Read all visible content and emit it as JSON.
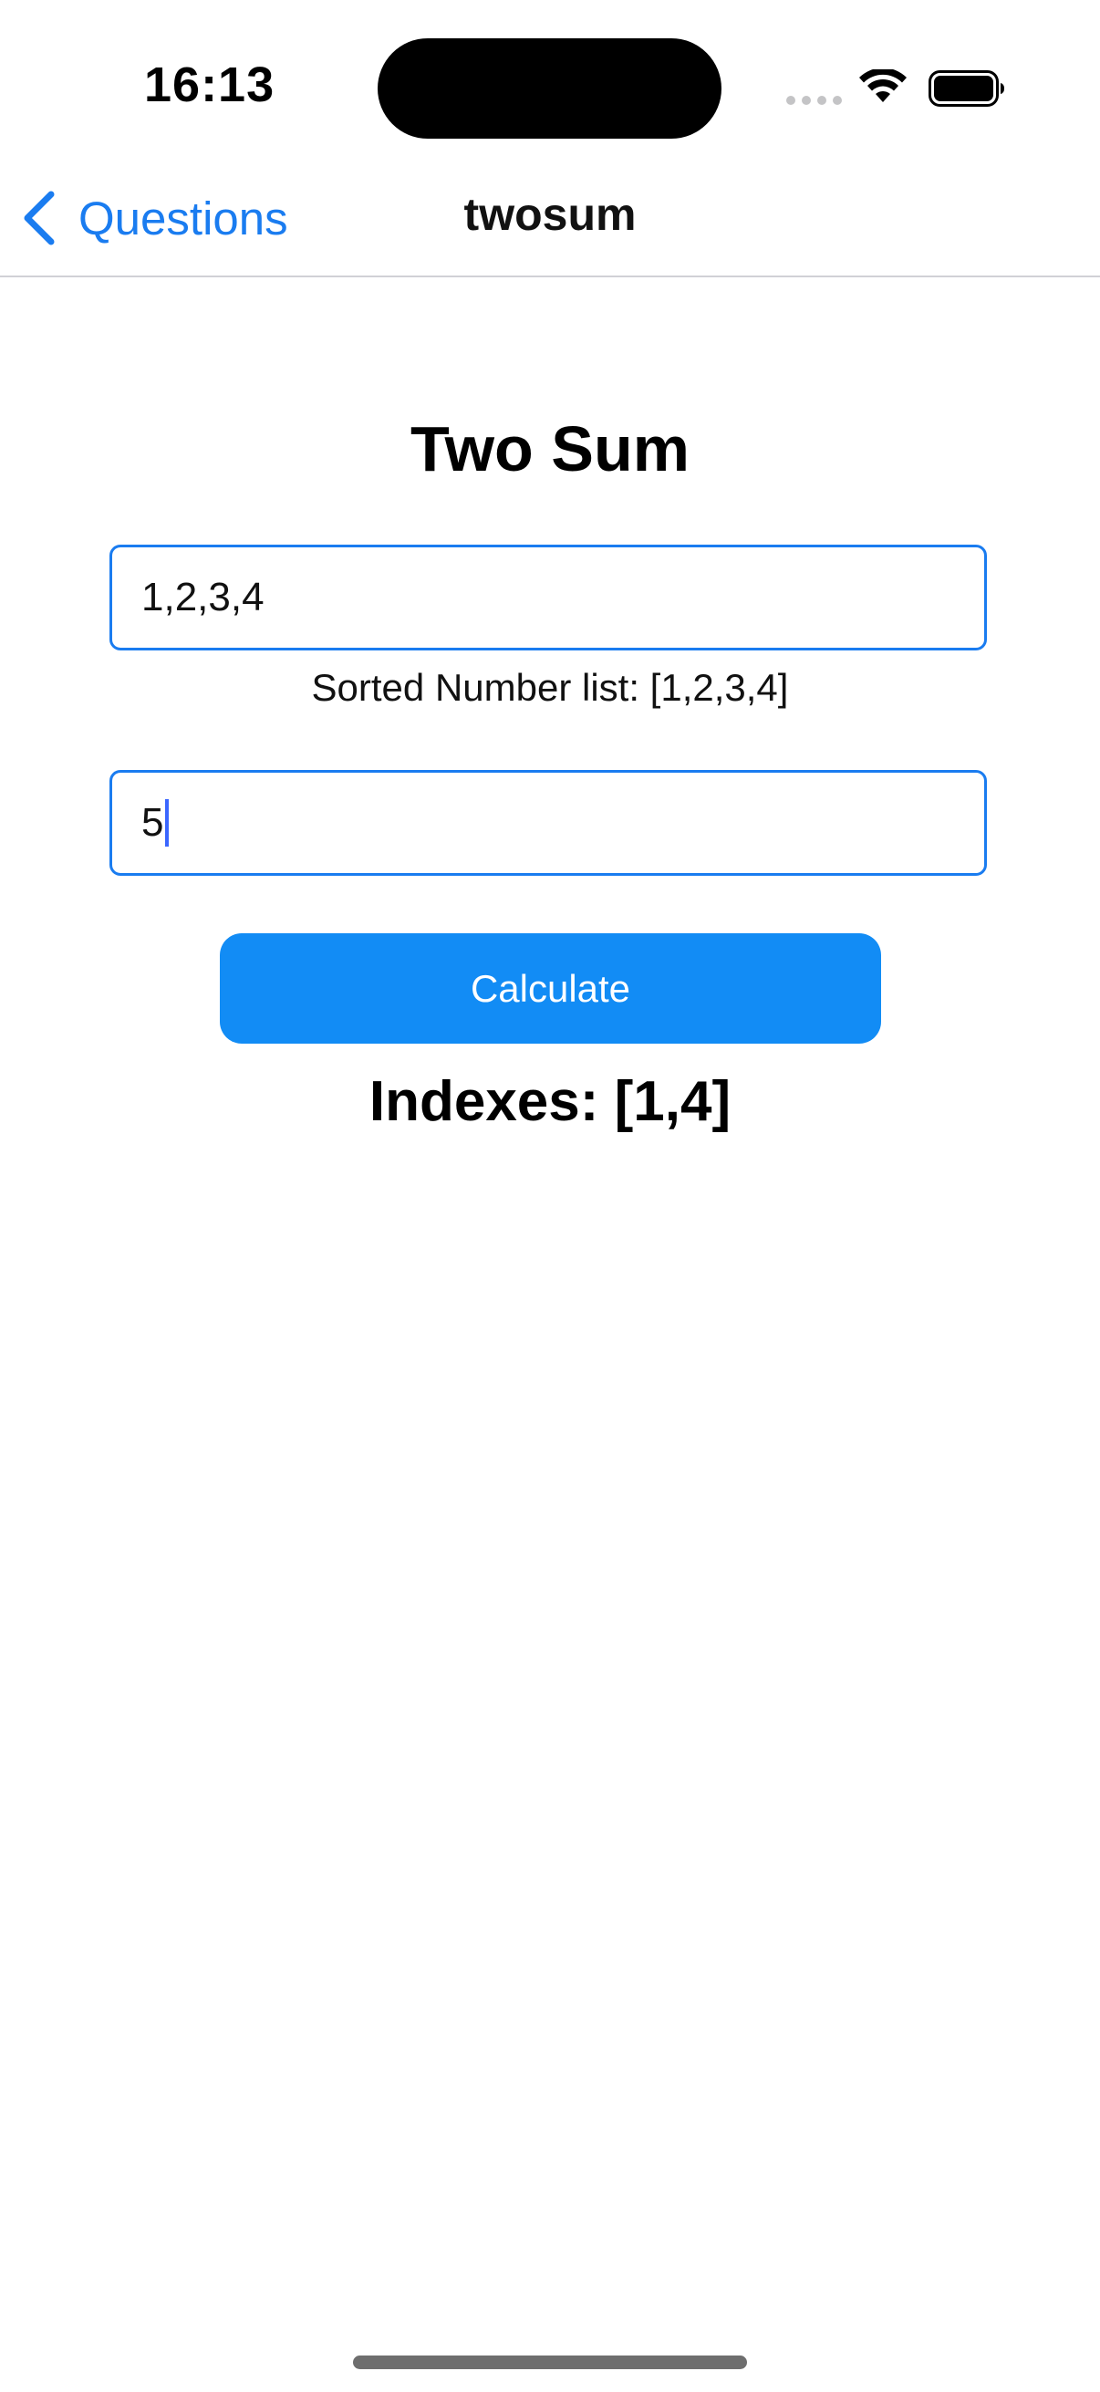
{
  "status_bar": {
    "time": "16:13"
  },
  "nav": {
    "back_label": "Questions",
    "title": "twosum"
  },
  "main": {
    "title": "Two Sum",
    "numbers_input_value": "1,2,3,4",
    "sorted_label": "Sorted Number list: [1,2,3,4]",
    "target_input_value": "5",
    "calculate_label": "Calculate",
    "result_text": "Indexes: [1,4]"
  },
  "colors": {
    "accent": "#1a7cf0",
    "button": "#128cf5",
    "caret": "#3a66ff"
  },
  "icons": [
    "chevron-left-icon",
    "wifi-icon",
    "battery-icon",
    "signal-dots-icon"
  ]
}
